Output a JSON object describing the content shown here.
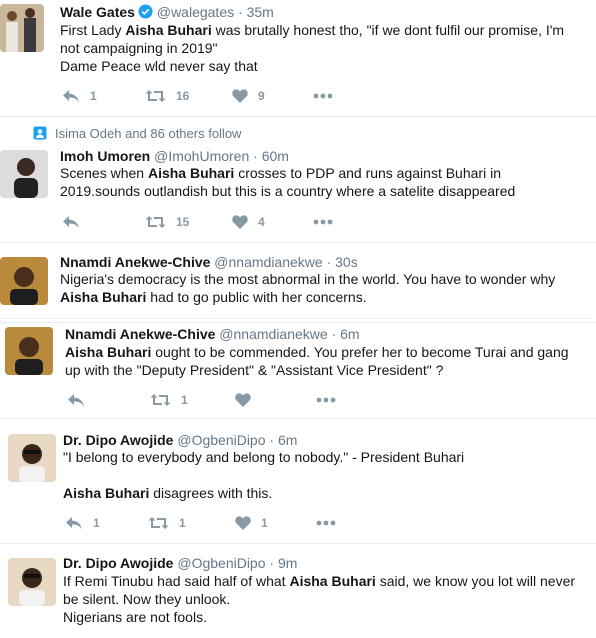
{
  "tweets": [
    {
      "name": "Wale Gates",
      "handle": "@walegates",
      "time": "35m",
      "body_parts": [
        {
          "text": "First Lady ",
          "bold": false
        },
        {
          "text": "Aisha Buhari",
          "bold": true
        },
        {
          "text": " was brutally honest tho, \"if we dont fulfil our promise, I'm\nnot campaigning in 2019\"\nDame Peace wld never say that",
          "bold": false
        }
      ],
      "replies": "1",
      "retweets": "16",
      "likes": "9"
    },
    {
      "social_context": "Isima Odeh and 86 others follow",
      "name": "Imoh Umoren",
      "handle": "@ImohUmoren",
      "time": "60m",
      "body_parts": [
        {
          "text": "Scenes when ",
          "bold": false
        },
        {
          "text": "Aisha Buhari",
          "bold": true
        },
        {
          "text": " crosses to PDP and runs against Buhari in\n2019.sounds outlandish but this is a country where a satelite disappeared",
          "bold": false
        }
      ],
      "replies": "",
      "retweets": "15",
      "likes": "4"
    },
    {
      "name": "Nnamdi Anekwe-Chive",
      "handle": "@nnamdianekwe",
      "time": "30s",
      "body_parts": [
        {
          "text": "Nigeria's democracy is the most abnormal in the world. You have to wonder why\n",
          "bold": false
        },
        {
          "text": "Aisha Buhari",
          "bold": true
        },
        {
          "text": " had to go public with her concerns.",
          "bold": false
        }
      ]
    },
    {
      "name": "Nnamdi Anekwe-Chive",
      "handle": "@nnamdianekwe",
      "time": "6m",
      "body_parts": [
        {
          "text": "Aisha Buhari",
          "bold": true
        },
        {
          "text": " ought to be commended. You prefer her to become Turai and gang\nup with the \"Deputy President\" & \"Assistant Vice President\" ?",
          "bold": false
        }
      ],
      "replies": "",
      "retweets": "1",
      "likes": ""
    },
    {
      "name": "Dr. Dipo Awojide",
      "handle": "@OgbeniDipo",
      "time": "6m",
      "body_parts": [
        {
          "text": "\"I belong to everybody and belong to nobody.\" - President Buhari\n\n",
          "bold": false
        },
        {
          "text": "Aisha Buhari",
          "bold": true
        },
        {
          "text": " disagrees with this.",
          "bold": false
        }
      ],
      "replies": "1",
      "retweets": "1",
      "likes": "1"
    },
    {
      "name": "Dr. Dipo Awojide",
      "handle": "@OgbeniDipo",
      "time": "9m",
      "body_parts": [
        {
          "text": "If Remi Tinubu had said half of what ",
          "bold": false
        },
        {
          "text": "Aisha Buhari",
          "bold": true
        },
        {
          "text": " said, we know you lot will never\nbe silent. Now they unlook.\nNigerians are not fools.",
          "bold": false
        }
      ]
    }
  ]
}
